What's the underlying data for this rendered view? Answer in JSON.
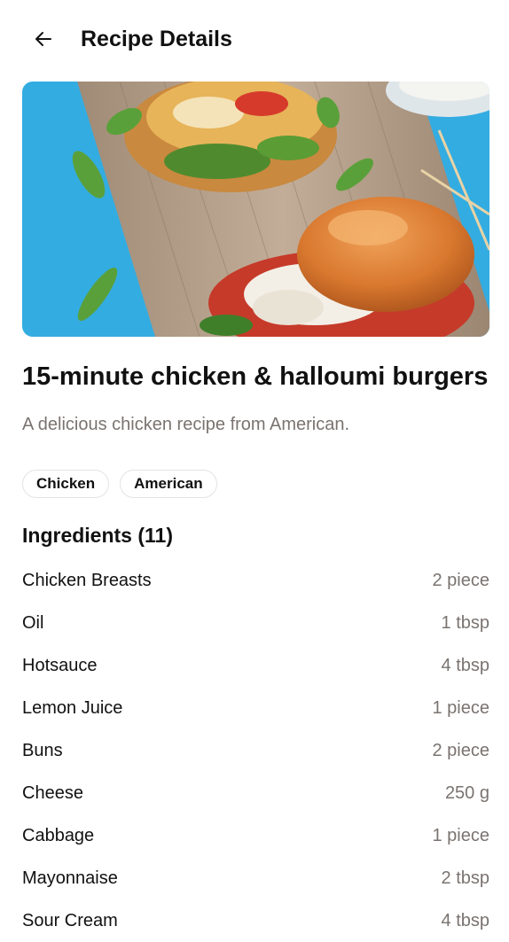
{
  "header": {
    "back_icon": "arrow-left-icon",
    "title": "Recipe Details"
  },
  "recipe": {
    "image_alt": "chicken-halloumi-burgers-photo",
    "title": "15-minute chicken & halloumi burgers",
    "description": "A delicious chicken recipe from American.",
    "tags": [
      "Chicken",
      "American"
    ]
  },
  "ingredients": {
    "heading": "Ingredients (11)",
    "items": [
      {
        "name": "Chicken Breasts",
        "qty": "2 piece"
      },
      {
        "name": "Oil",
        "qty": "1 tbsp"
      },
      {
        "name": "Hotsauce",
        "qty": "4 tbsp"
      },
      {
        "name": "Lemon Juice",
        "qty": "1 piece"
      },
      {
        "name": "Buns",
        "qty": "2 piece"
      },
      {
        "name": "Cheese",
        "qty": "250 g"
      },
      {
        "name": "Cabbage",
        "qty": "1 piece"
      },
      {
        "name": "Mayonnaise",
        "qty": "2 tbsp"
      },
      {
        "name": "Sour Cream",
        "qty": "4 tbsp"
      }
    ]
  },
  "colors": {
    "text_primary": "#111111",
    "text_secondary": "#7a7370",
    "tag_border": "#e3e3e3"
  }
}
